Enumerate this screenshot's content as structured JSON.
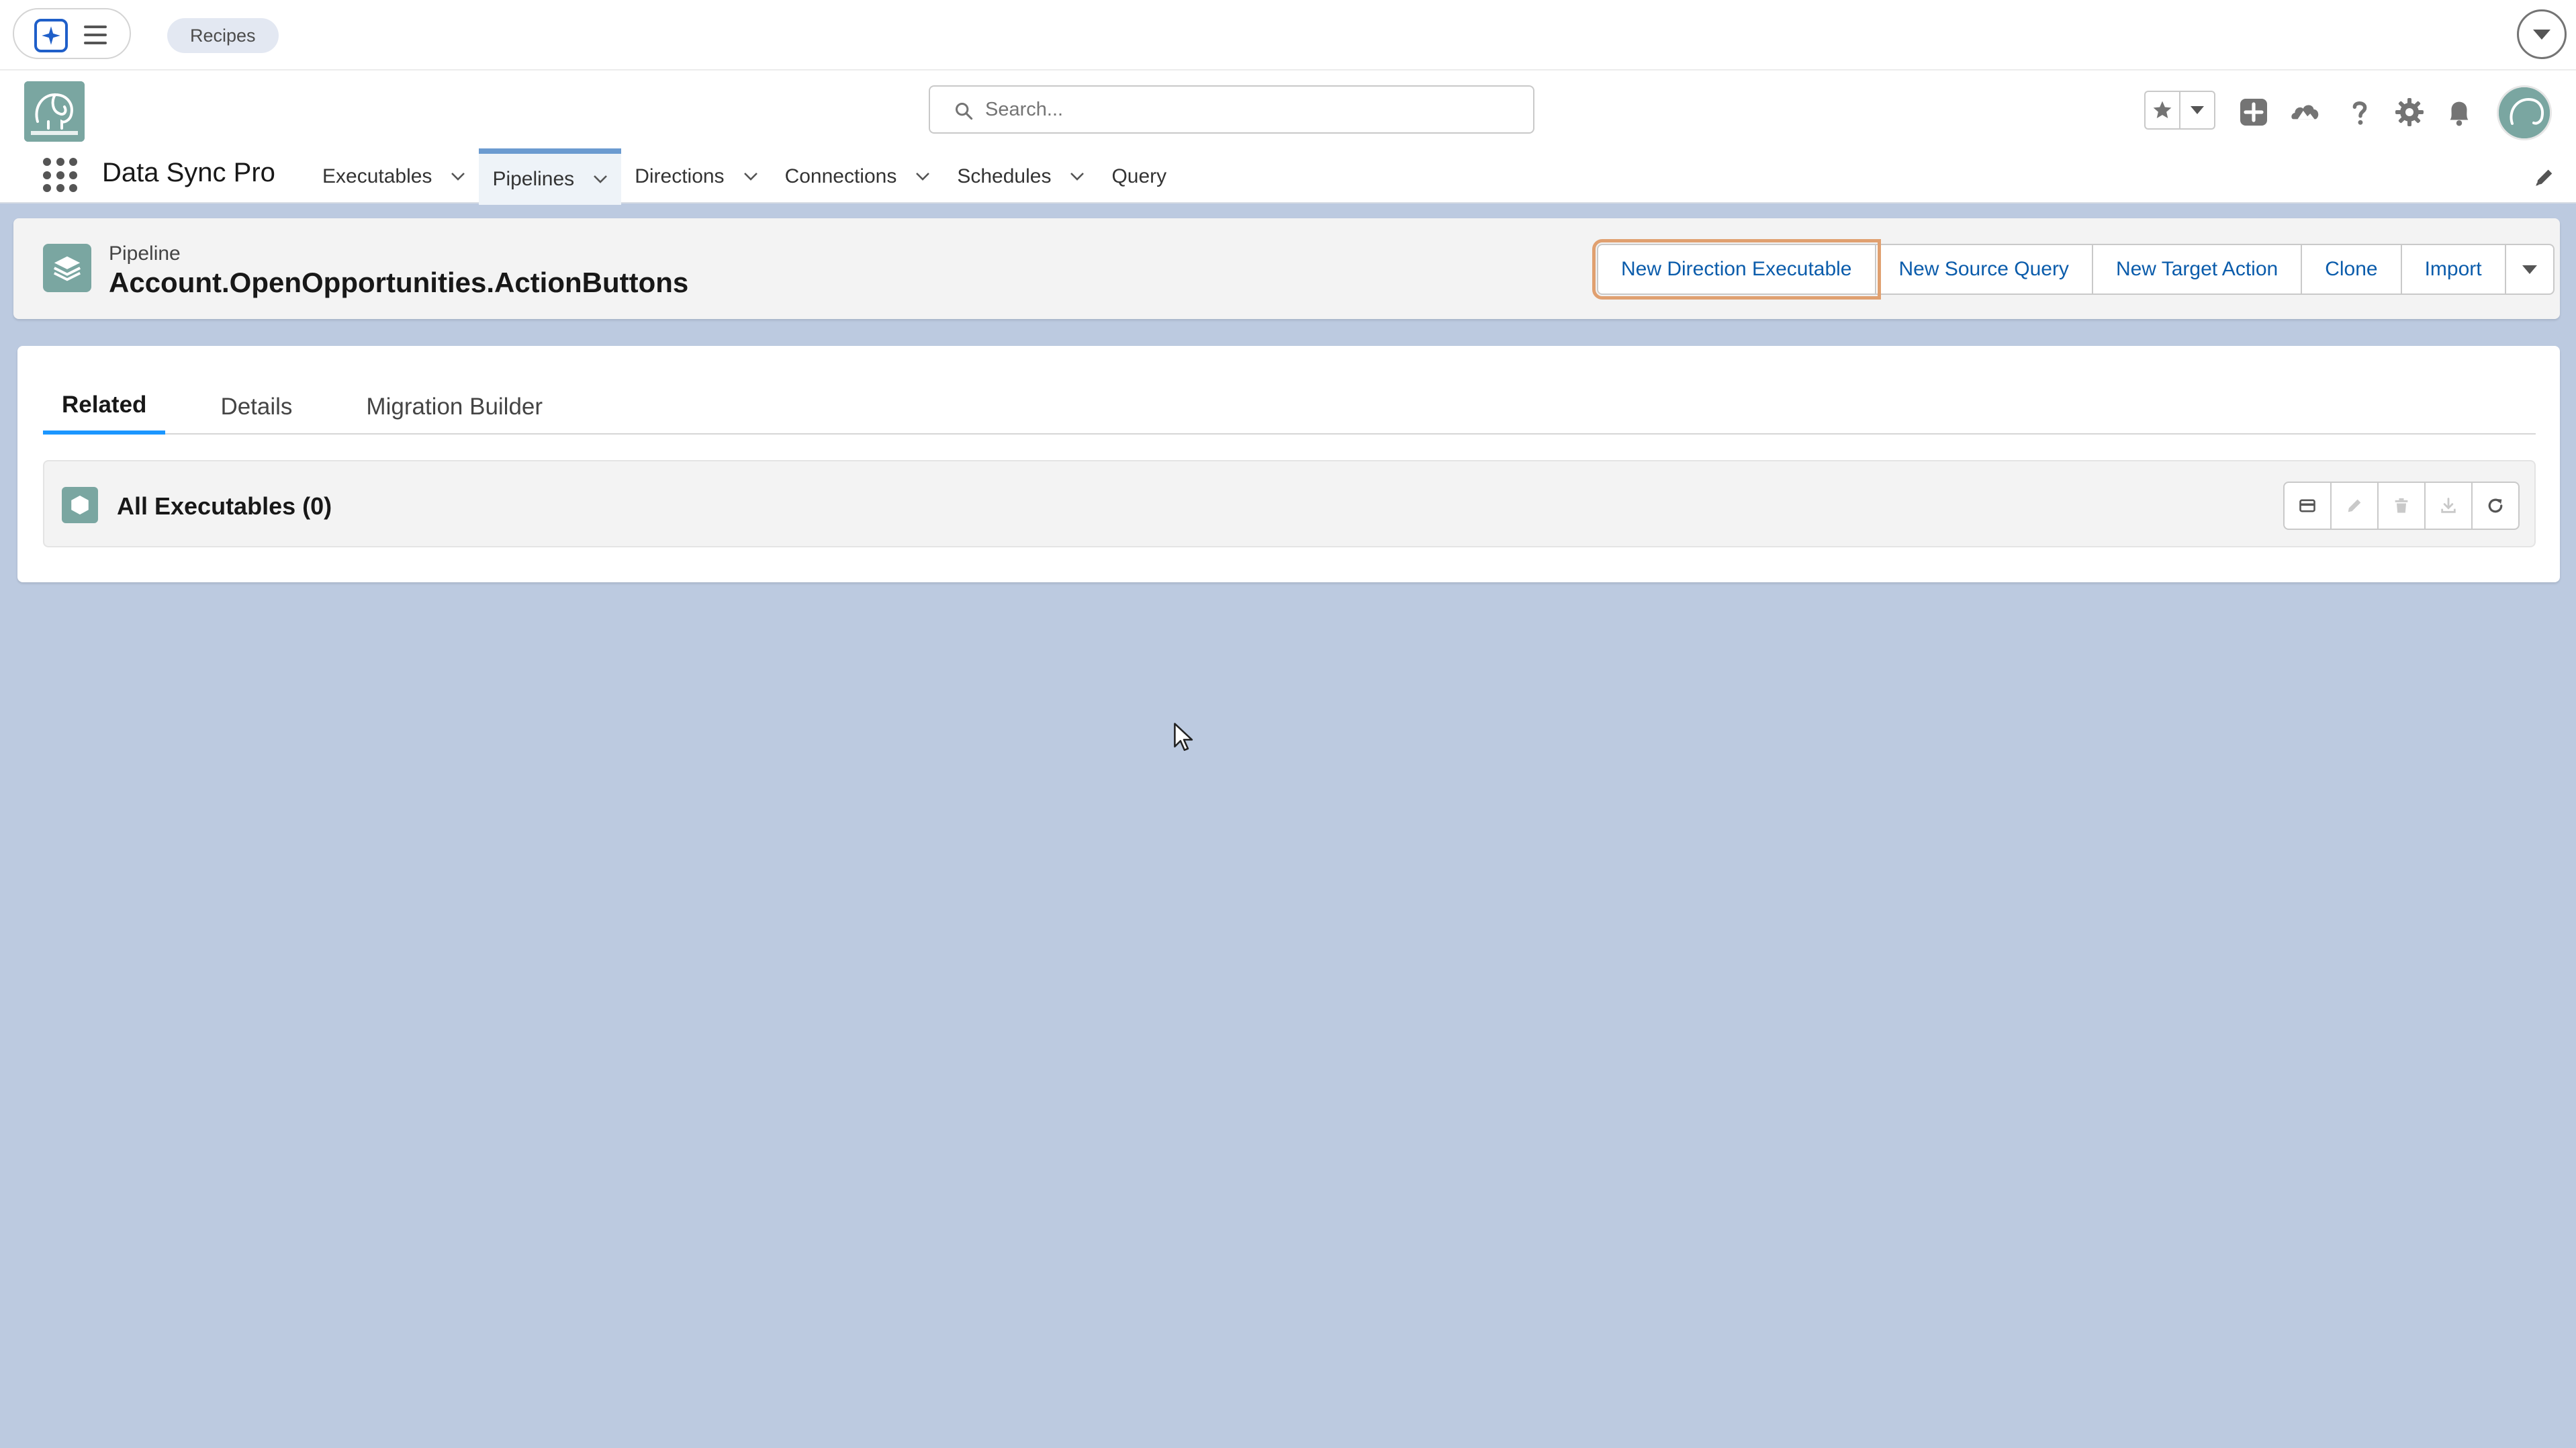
{
  "topbar": {
    "recipes_label": "Recipes"
  },
  "header": {
    "search_placeholder": "Search..."
  },
  "nav": {
    "app_name": "Data Sync Pro",
    "items": [
      {
        "label": "Executables",
        "has_menu": true,
        "active": false
      },
      {
        "label": "Pipelines",
        "has_menu": true,
        "active": true
      },
      {
        "label": "Directions",
        "has_menu": true,
        "active": false
      },
      {
        "label": "Connections",
        "has_menu": true,
        "active": false
      },
      {
        "label": "Schedules",
        "has_menu": true,
        "active": false
      },
      {
        "label": "Query",
        "has_menu": false,
        "active": false
      }
    ]
  },
  "record": {
    "type_label": "Pipeline",
    "title": "Account.OpenOpportunities.ActionButtons",
    "actions": [
      "New Direction Executable",
      "New Source Query",
      "New Target Action",
      "Clone",
      "Import"
    ]
  },
  "tabs": [
    {
      "label": "Related",
      "active": true
    },
    {
      "label": "Details",
      "active": false
    },
    {
      "label": "Migration Builder",
      "active": false
    }
  ],
  "related_list": {
    "title": "All Executables (0)"
  },
  "colors": {
    "page_bg": "#bccae0",
    "brand_teal": "#7aa6a1",
    "link_blue": "#0b5cab",
    "active_tab": "#1b96ff",
    "focus_ring": "#e0a070"
  }
}
